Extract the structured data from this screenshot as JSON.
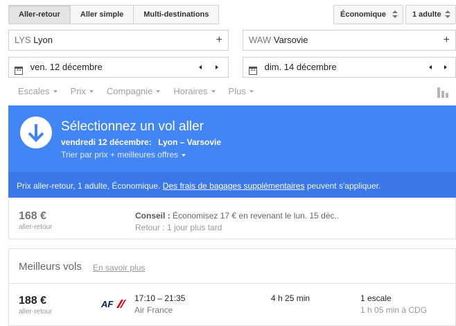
{
  "trip_type": {
    "options": [
      "Aller-retour",
      "Aller simple",
      "Multi-destinations"
    ],
    "selected": "Aller-retour"
  },
  "cabin": {
    "value": "Économique"
  },
  "passengers": {
    "value": "1 adulte"
  },
  "origin": {
    "code": "LYS",
    "city": "Lyon",
    "add": "+"
  },
  "destination": {
    "code": "WAW",
    "city": "Varsovie",
    "add": "+"
  },
  "depart_date": {
    "icon_text": "31",
    "value": "ven. 12 décembre"
  },
  "return_date": {
    "icon_text": "31",
    "value": "dim. 14 décembre"
  },
  "filters": [
    "Escales",
    "Prix",
    "Compagnie",
    "Horaires",
    "Plus"
  ],
  "banner": {
    "title": "Sélectionnez un vol aller",
    "date": "vendredi 12 décembre:",
    "route": "Lyon – Varsovie",
    "sort": "Trier par prix + meilleures offres",
    "note_before": "Prix aller-retour, 1 adulte, Économique.",
    "note_link": "Des frais de bagages supplémentaires",
    "note_after": "peuvent s'appliquer."
  },
  "tip": {
    "price": "168 €",
    "price_label": "aller-retour",
    "label": "Conseil :",
    "text": "Économisez 17 € en revenant le lun. 15 déc..",
    "retour": "Retour : 1 jour plus tard"
  },
  "best": {
    "title": "Meilleurs vols",
    "link": "En savoir plus",
    "flights": [
      {
        "price": "188 €",
        "price_label": "aller-retour",
        "times": "17:10 – 21:35",
        "airline": "Air France",
        "logo": "AF",
        "duration": "4 h 25 min",
        "stops": "1 escale",
        "stop_detail": "1 h 05 min à CDG"
      }
    ]
  },
  "colors": {
    "banner": "#4285f4",
    "banner_dark": "#3b78e7",
    "af_blue": "#002157",
    "af_red": "#e30613"
  },
  "icons": [
    "chevron-updown-icon",
    "plus-icon",
    "calendar-icon",
    "arrow-left-icon",
    "arrow-right-icon",
    "dropdown-caret-icon",
    "bar-chart-icon",
    "down-arrow-circle-icon",
    "air-france-logo"
  ]
}
